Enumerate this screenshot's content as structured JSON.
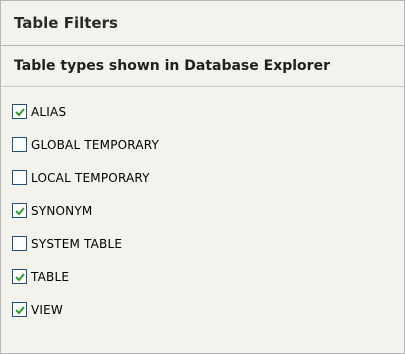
{
  "panel": {
    "title": "Table Filters",
    "section_title": "Table types shown in Database Explorer"
  },
  "items": [
    {
      "label": "ALIAS",
      "checked": true
    },
    {
      "label": "GLOBAL TEMPORARY",
      "checked": false
    },
    {
      "label": "LOCAL TEMPORARY",
      "checked": false
    },
    {
      "label": "SYNONYM",
      "checked": true
    },
    {
      "label": "SYSTEM TABLE",
      "checked": false
    },
    {
      "label": "TABLE",
      "checked": true
    },
    {
      "label": "VIEW",
      "checked": true
    }
  ],
  "colors": {
    "checkmark": "#2f9c2f",
    "panel_background": "#f3f2ec",
    "checkbox_border": "#1c5180"
  },
  "icons": {
    "checked": "checkmark-icon"
  }
}
